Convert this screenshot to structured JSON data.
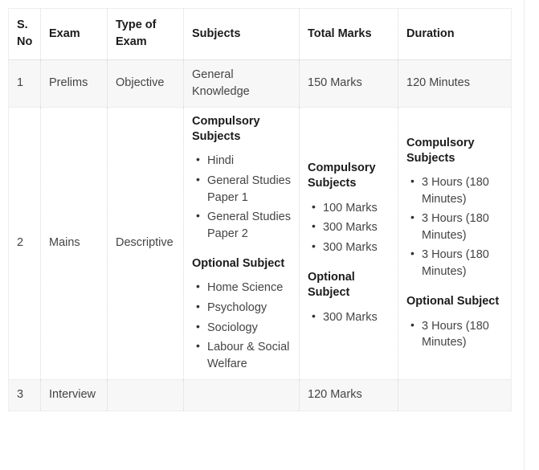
{
  "table": {
    "columns": [
      {
        "key": "sno",
        "label": "S. No"
      },
      {
        "key": "exam",
        "label": "Exam"
      },
      {
        "key": "type",
        "label": "Type of Exam"
      },
      {
        "key": "subjects",
        "label": "Subjects"
      },
      {
        "key": "marks",
        "label": "Total Marks"
      },
      {
        "key": "duration",
        "label": "Duration"
      }
    ],
    "rows": [
      {
        "sno": "1",
        "exam": "Prelims",
        "type": "Objective",
        "subjects_plain": "General Knowledge",
        "marks_plain": "150 Marks",
        "duration_plain": "120 Minutes"
      },
      {
        "sno": "2",
        "exam": "Mains",
        "type": "Descriptive",
        "subjects_group1_title": "Compulsory Subjects",
        "subjects_group1_items": [
          "Hindi",
          "General Studies Paper 1",
          "General Studies Paper 2"
        ],
        "subjects_group2_title": "Optional Subject",
        "subjects_group2_items": [
          "Home Science",
          "Psychology",
          "Sociology",
          "Labour & Social Welfare"
        ],
        "marks_group1_title": "Compulsory Subjects",
        "marks_group1_items": [
          "100 Marks",
          "300 Marks",
          "300 Marks"
        ],
        "marks_group2_title": "Optional Subject",
        "marks_group2_items": [
          "300 Marks"
        ],
        "duration_group1_title": "Compulsory Subjects",
        "duration_group1_items": [
          "3 Hours (180 Minutes)",
          "3 Hours (180 Minutes)",
          "3 Hours (180 Minutes)"
        ],
        "duration_group2_title": "Optional Subject",
        "duration_group2_items": [
          "3 Hours (180 Minutes)"
        ]
      },
      {
        "sno": "3",
        "exam": "Interview",
        "type": "",
        "subjects_plain": "",
        "marks_plain": "120 Marks",
        "duration_plain": ""
      }
    ]
  },
  "colors": {
    "header_text": "#1b1b1b",
    "body_text": "#444444",
    "row_stripe": "#f7f7f7",
    "border": "#eeeeee",
    "inner_border": "#d8d8d8"
  }
}
